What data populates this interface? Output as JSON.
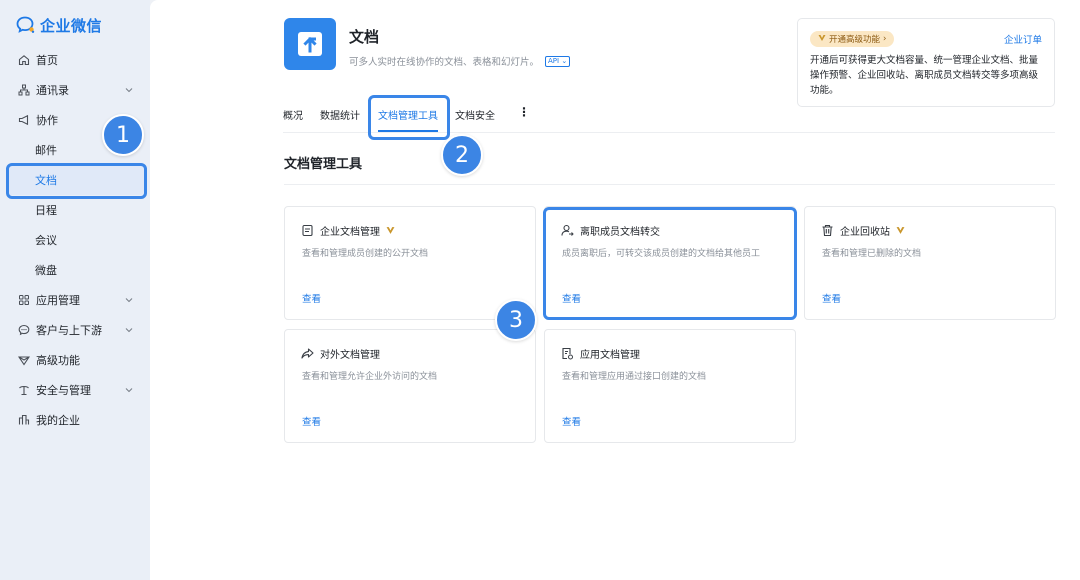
{
  "brand": {
    "name": "企业微信",
    "accent": "#1e79e6"
  },
  "sidebar": {
    "items": [
      {
        "label": "首页",
        "icon": "home-icon"
      },
      {
        "label": "通讯录",
        "icon": "org-chart-icon",
        "expandable": true
      },
      {
        "label": "协作",
        "icon": "megaphone-icon",
        "expandable": false
      },
      {
        "label": "邮件",
        "sub": true
      },
      {
        "label": "文档",
        "sub": true,
        "active": true
      },
      {
        "label": "日程",
        "sub": true
      },
      {
        "label": "会议",
        "sub": true
      },
      {
        "label": "微盘",
        "sub": true
      },
      {
        "label": "应用管理",
        "icon": "grid-icon",
        "expandable": true
      },
      {
        "label": "客户与上下游",
        "icon": "chat-icon",
        "expandable": true
      },
      {
        "label": "高级功能",
        "icon": "diamond-icon"
      },
      {
        "label": "安全与管理",
        "icon": "shield-icon",
        "expandable": true
      },
      {
        "label": "我的企业",
        "icon": "building-icon"
      }
    ]
  },
  "app": {
    "title": "文档",
    "description": "可多人实时在线协作的文档、表格和幻灯片。",
    "api_badge": "API"
  },
  "promo": {
    "badge": "开通高级功能",
    "link": "企业订单",
    "text": "开通后可获得更大文档容量、统一管理企业文档、批量操作预警、企业回收站、离职成员文档转交等多项高级功能。"
  },
  "tabs": [
    {
      "label": "概况"
    },
    {
      "label": "数据统计"
    },
    {
      "label": "文档管理工具",
      "active": true
    },
    {
      "label": "文档安全"
    }
  ],
  "tab_more": "⋮",
  "section": {
    "title": "文档管理工具"
  },
  "cards": [
    {
      "title": "企业文档管理",
      "icon": "document-icon",
      "vip": true,
      "desc": "查看和管理成员创建的公开文档",
      "link": "查看"
    },
    {
      "title": "离职成员文档转交",
      "icon": "user-transfer-icon",
      "vip": false,
      "desc": "成员离职后，可转交该成员创建的文档给其他员工",
      "link": "查看"
    },
    {
      "title": "企业回收站",
      "icon": "trash-icon",
      "vip": true,
      "desc": "查看和管理已删除的文档",
      "link": "查看"
    },
    {
      "title": "对外文档管理",
      "icon": "share-icon",
      "vip": false,
      "desc": "查看和管理允许企业外访问的文档",
      "link": "查看"
    },
    {
      "title": "应用文档管理",
      "icon": "app-document-icon",
      "vip": false,
      "desc": "查看和管理应用通过接口创建的文档",
      "link": "查看"
    }
  ],
  "markers": [
    "1",
    "2",
    "3"
  ],
  "colors": {
    "highlight": "#3a86e8",
    "marker": "#3c85e4",
    "vip_badge": "#c9962b"
  }
}
